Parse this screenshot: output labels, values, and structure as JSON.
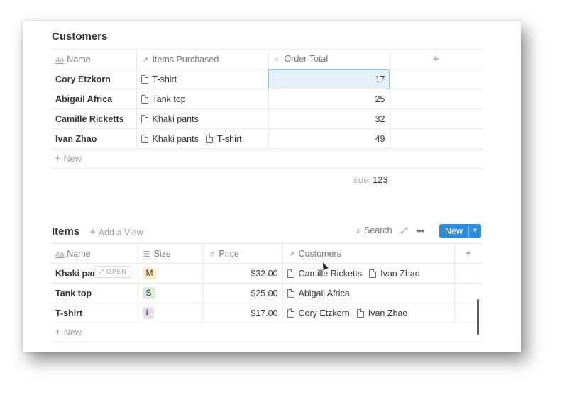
{
  "customers": {
    "title": "Customers",
    "columns": [
      {
        "icon": "Aa",
        "label": "Name"
      },
      {
        "icon": "↗",
        "label": "Items Purchased"
      },
      {
        "icon": "⌕",
        "label": "Order Total"
      },
      {
        "icon": "+",
        "label": ""
      }
    ],
    "rows": [
      {
        "name": "Cory Etzkorn",
        "items": [
          "T-shirt"
        ],
        "total": "17"
      },
      {
        "name": "Abigail Africa",
        "items": [
          "Tank top"
        ],
        "total": "25"
      },
      {
        "name": "Camille Ricketts",
        "items": [
          "Khaki pants"
        ],
        "total": "32"
      },
      {
        "name": "Ivan Zhao",
        "items": [
          "Khaki pants",
          "T-shirt"
        ],
        "total": "49"
      }
    ],
    "new_label": "New",
    "sum_label": "SUM",
    "sum_value": "123"
  },
  "items": {
    "title": "Items",
    "add_view": "Add a View",
    "search_label": "Search",
    "new_button": "New",
    "open_label": "OPEN",
    "columns": [
      {
        "icon": "Aa",
        "label": "Name"
      },
      {
        "icon": "☰",
        "label": "Size"
      },
      {
        "icon": "#",
        "label": "Price"
      },
      {
        "icon": "↗",
        "label": "Customers"
      },
      {
        "icon": "+",
        "label": ""
      }
    ],
    "rows": [
      {
        "name": "Khaki pan",
        "size": "M",
        "size_bg": "#fdecc8",
        "price": "$32.00",
        "customers": [
          "Camille Ricketts",
          "Ivan Zhao"
        ]
      },
      {
        "name": "Tank top",
        "size": "S",
        "size_bg": "#dbeddb",
        "price": "$25.00",
        "customers": [
          "Abigail Africa"
        ]
      },
      {
        "name": "T-shirt",
        "size": "L",
        "size_bg": "#e8deee",
        "price": "$17.00",
        "customers": [
          "Cory Etzkorn",
          "Ivan Zhao"
        ]
      }
    ],
    "new_label": "New"
  },
  "colors": {
    "accent": "#2f8ad7",
    "selected_bg": "#e6f1fa"
  }
}
